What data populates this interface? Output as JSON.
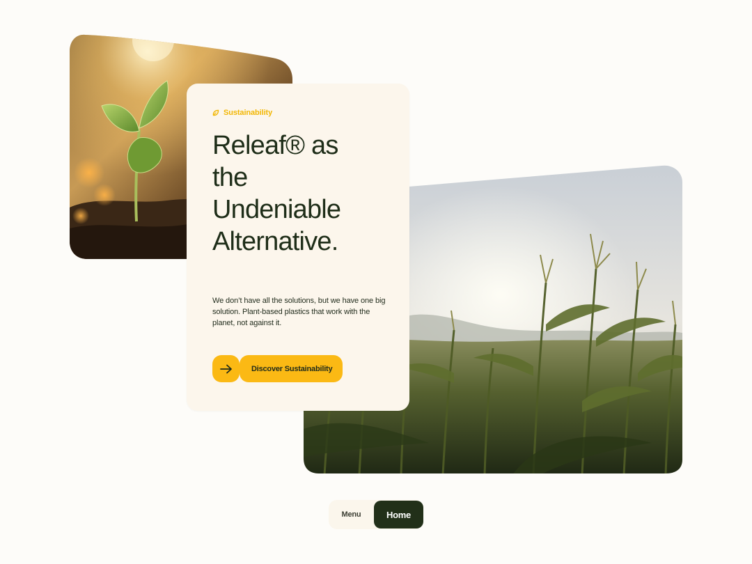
{
  "card": {
    "eyebrow": "Sustainability",
    "headline_lines": [
      "Releaf® as",
      "the",
      "Undeniable",
      "Alternative."
    ],
    "body": "We don’t have all the solutions, but we have one big solution. Plant-based plastics that work with the planet, not against it.",
    "cta_label": "Discover Sustainability",
    "eyebrow_icon": "leaf-icon",
    "cta_icon": "arrow-right-icon"
  },
  "images": {
    "sprout": "seedling-photo",
    "field": "cornfield-photo"
  },
  "nav": {
    "menu_label": "Menu",
    "home_label": "Home"
  },
  "colors": {
    "accent": "#fbb914",
    "eyebrow": "#f2b705",
    "headline": "#1e2d18",
    "card_background": "#fcf6ec",
    "page_background": "#fdfcf9",
    "nav_active": "#223019"
  }
}
